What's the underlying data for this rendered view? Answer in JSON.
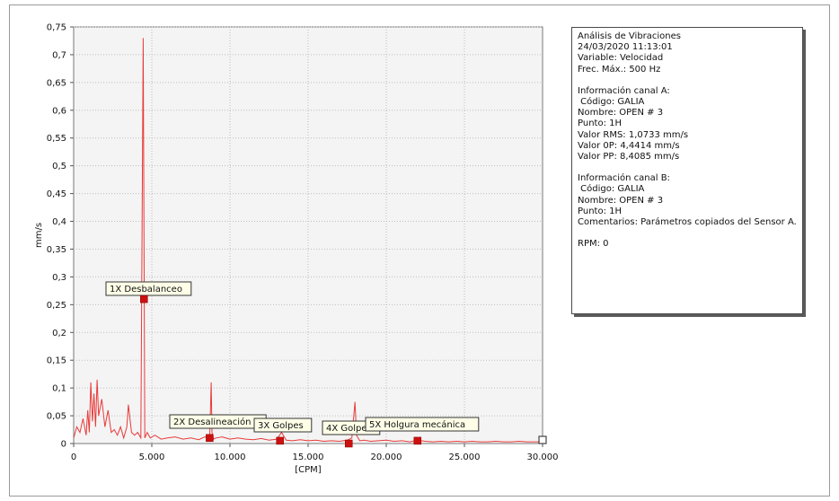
{
  "chart_data": {
    "type": "line",
    "xlabel": "[CPM]",
    "ylabel": "mm/s",
    "xlim": [
      0,
      30000
    ],
    "ylim": [
      0,
      0.75
    ],
    "x_ticks": [
      0,
      5000,
      10000,
      15000,
      20000,
      25000,
      30000
    ],
    "x_tick_labels": [
      "0",
      "5.000",
      "10.000",
      "15.000",
      "20.000",
      "25.000",
      "30.000"
    ],
    "y_ticks": [
      0,
      0.05,
      0.1,
      0.15,
      0.2,
      0.25,
      0.3,
      0.35,
      0.4,
      0.45,
      0.5,
      0.55,
      0.6,
      0.65,
      0.7,
      0.75
    ],
    "y_tick_labels": [
      "0",
      "0,05",
      "0,1",
      "0,15",
      "0,2",
      "0,25",
      "0,3",
      "0,35",
      "0,4",
      "0,45",
      "0,5",
      "0,55",
      "0,6",
      "0,65",
      "0,7",
      "0,75"
    ],
    "grid": true,
    "series": [
      {
        "color": "#e83a3a",
        "x": [
          0,
          200,
          400,
          600,
          800,
          900,
          1000,
          1100,
          1200,
          1300,
          1400,
          1500,
          1600,
          1800,
          2000,
          2200,
          2400,
          2600,
          2800,
          3000,
          3200,
          3400,
          3500,
          3700,
          3900,
          4100,
          4300,
          4450,
          4550,
          4700,
          4900,
          5200,
          5600,
          6000,
          6500,
          7000,
          7500,
          8000,
          8400,
          8700,
          8800,
          8850,
          8950,
          9100,
          9500,
          10000,
          10500,
          11000,
          11500,
          12000,
          12500,
          13000,
          13300,
          13600,
          14000,
          14500,
          15000,
          15500,
          16000,
          16500,
          17000,
          17500,
          17800,
          18000,
          18100,
          18300,
          18600,
          19000,
          19500,
          20000,
          20500,
          21000,
          21500,
          22000,
          22500,
          23000,
          23500,
          24000,
          24500,
          25000,
          25500,
          26000,
          26500,
          27000,
          27500,
          28000,
          28500,
          29000,
          29500,
          30000
        ],
        "y": [
          0.01,
          0.03,
          0.02,
          0.045,
          0.015,
          0.06,
          0.02,
          0.11,
          0.04,
          0.09,
          0.03,
          0.115,
          0.05,
          0.08,
          0.03,
          0.06,
          0.02,
          0.025,
          0.015,
          0.03,
          0.01,
          0.03,
          0.07,
          0.02,
          0.015,
          0.02,
          0.01,
          0.73,
          0.01,
          0.02,
          0.01,
          0.015,
          0.008,
          0.01,
          0.012,
          0.008,
          0.01,
          0.007,
          0.012,
          0.008,
          0.11,
          0.02,
          0.008,
          0.01,
          0.012,
          0.008,
          0.01,
          0.008,
          0.007,
          0.009,
          0.006,
          0.008,
          0.02,
          0.006,
          0.005,
          0.007,
          0.005,
          0.006,
          0.004,
          0.005,
          0.004,
          0.006,
          0.01,
          0.075,
          0.015,
          0.005,
          0.006,
          0.004,
          0.005,
          0.006,
          0.004,
          0.005,
          0.003,
          0.006,
          0.004,
          0.003,
          0.004,
          0.003,
          0.004,
          0.003,
          0.004,
          0.003,
          0.003,
          0.004,
          0.003,
          0.003,
          0.004,
          0.003,
          0.003,
          0.003
        ]
      }
    ],
    "annotations": [
      {
        "label": "1X Desbalanceo",
        "x": 4500,
        "y": 0.26
      },
      {
        "label": "2X Desalineación",
        "x": 8700,
        "y": 0.01
      },
      {
        "label": "3X Golpes",
        "x": 13200,
        "y": 0.005
      },
      {
        "label": "4X Golpes",
        "x": 17600,
        "y": 0.0
      },
      {
        "label": "5X Holgura mecánica",
        "x": 22000,
        "y": 0.005
      }
    ]
  },
  "info_panel": {
    "lines": [
      "Análisis de Vibraciones",
      "24/03/2020 11:13:01",
      "Variable: Velocidad",
      "Frec. Máx.: 500 Hz",
      "",
      "Información canal A:",
      " Código: GALIA",
      "Nombre: OPEN # 3",
      "Punto: 1H",
      "Valor RMS: 1,0733 mm/s",
      "Valor 0P: 4,4414 mm/s",
      "Valor PP: 8,4085 mm/s",
      "",
      "Información canal B:",
      " Código: GALIA",
      "Nombre: OPEN # 3",
      "Punto: 1H",
      "Comentarios: Parámetros copiados del Sensor A.",
      "",
      "RPM: 0"
    ]
  }
}
